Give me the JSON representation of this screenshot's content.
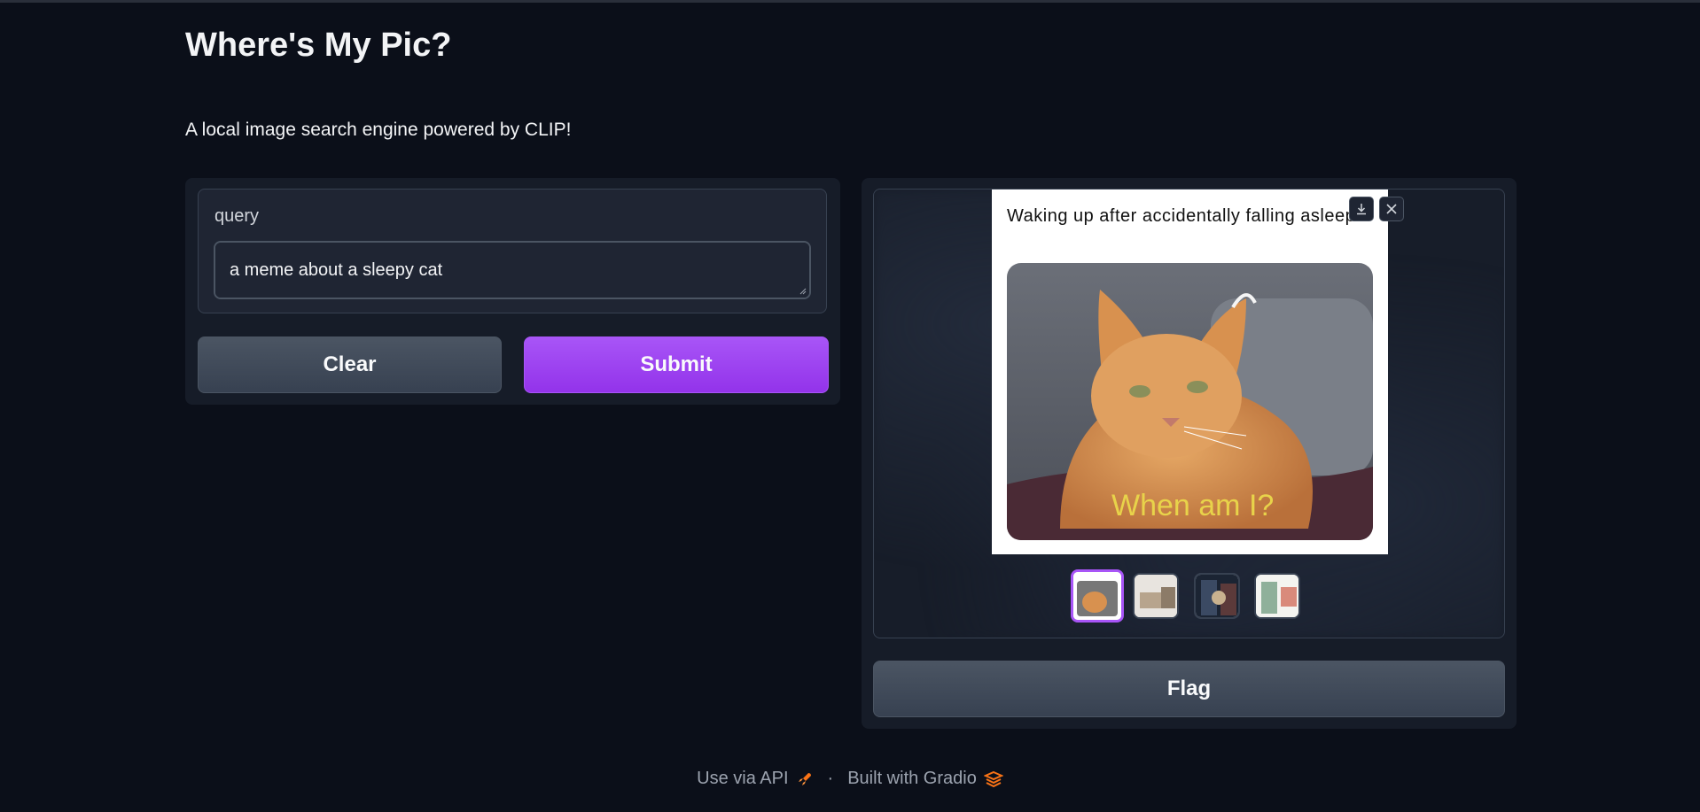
{
  "app": {
    "title": "Where's My Pic?",
    "description": "A local image search engine powered by CLIP!"
  },
  "form": {
    "query_label": "query",
    "query_value": "a meme about a sleepy cat",
    "clear_label": "Clear",
    "submit_label": "Submit"
  },
  "gallery": {
    "selected_index": 0,
    "meme_caption": "Waking up after accidentally falling asleep",
    "meme_overlay_text": "When am I?",
    "thumbnail_count": 4,
    "download_icon": "download-icon",
    "close_icon": "close-icon"
  },
  "flag_label": "Flag",
  "footer": {
    "api_text": "Use via API",
    "separator": "·",
    "built_text": "Built with Gradio"
  },
  "colors": {
    "background": "#0b0f19",
    "panel": "#161c28",
    "accent": "#a855f7",
    "button_secondary": "#4b5563",
    "gradio_orange": "#f97316"
  }
}
